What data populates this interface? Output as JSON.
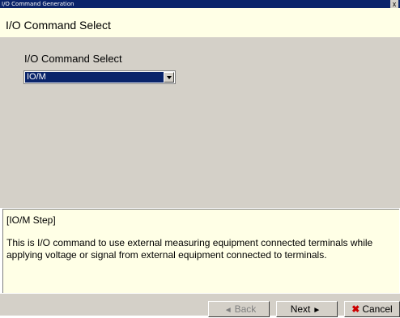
{
  "window": {
    "title": "I/O Command Generation",
    "close_glyph": "x"
  },
  "header": {
    "title": "I/O Command Select"
  },
  "main": {
    "field_label": "I/O Command Select",
    "select": {
      "selected_value": "IO/M"
    }
  },
  "description": {
    "title": "[IO/M Step]",
    "body": "This is I/O command to use external measuring equipment connected terminals while applying voltage or signal from external equipment connected to terminals."
  },
  "footer": {
    "back_label": "Back",
    "back_glyph": "◄",
    "next_label": "Next",
    "next_glyph": "►",
    "cancel_label": "Cancel",
    "cancel_glyph": "✖"
  },
  "colors": {
    "titlebar": "#0a246a",
    "header_bg": "#ffffe6",
    "panel_bg": "#d4d0c8",
    "selection": "#0a246a",
    "cancel_icon": "#cc0000"
  }
}
